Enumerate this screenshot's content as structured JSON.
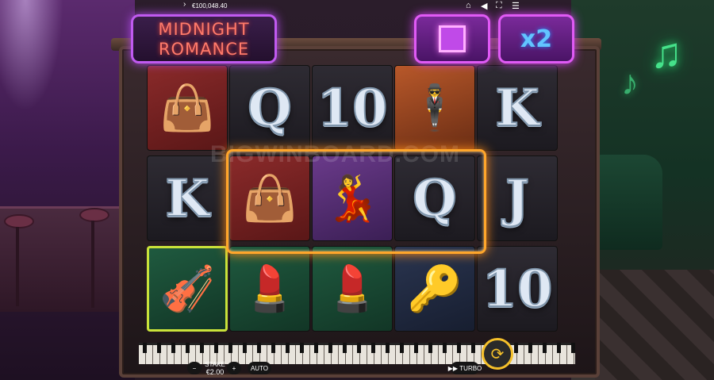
{
  "title": {
    "line1": "MIDNIGHT",
    "line2": "ROMANCE"
  },
  "feature": {
    "multiplier": "x2",
    "cube_icon": "cube-icon"
  },
  "topbar": {
    "balance": "€100,048.40",
    "icons": [
      "home-icon",
      "sound-icon",
      "fullscreen-icon",
      "menu-icon"
    ]
  },
  "watermark": "BIGWINBOARD.COM",
  "bottombar": {
    "stake_label": "STAKE",
    "stake_value": "€2.00",
    "minus": "−",
    "plus": "+",
    "auto": "AUTO",
    "turbo": "TURBO",
    "spin_icon": "spin-icon"
  },
  "grid": [
    [
      "handbag",
      "K",
      "man-bass",
      ""
    ],
    [
      "Q",
      "handbag",
      "compact",
      ""
    ],
    [
      "10",
      "woman",
      "compact",
      ""
    ],
    [
      "man-glasses",
      "Q",
      "keys",
      ""
    ],
    [
      "K",
      "J",
      "10",
      ""
    ]
  ],
  "reels": [
    [
      {
        "sym": "handbag",
        "style": "red",
        "glyph": "👜"
      },
      {
        "sym": "K",
        "style": "plain",
        "glyph": "K"
      },
      {
        "sym": "man-bass",
        "style": "green",
        "glyph": "🎻"
      }
    ],
    [
      {
        "sym": "Q",
        "style": "plain",
        "glyph": "Q"
      },
      {
        "sym": "handbag",
        "style": "red",
        "glyph": "👜"
      },
      {
        "sym": "compact",
        "style": "green",
        "glyph": "💄"
      }
    ],
    [
      {
        "sym": "10",
        "style": "plain",
        "glyph": "10"
      },
      {
        "sym": "woman",
        "style": "purple",
        "glyph": "💃"
      },
      {
        "sym": "compact",
        "style": "green",
        "glyph": "💄"
      }
    ],
    [
      {
        "sym": "man-glasses",
        "style": "orange",
        "glyph": "🕴"
      },
      {
        "sym": "Q",
        "style": "plain",
        "glyph": "Q"
      },
      {
        "sym": "keys",
        "style": "blue",
        "glyph": "🔑"
      }
    ],
    [
      {
        "sym": "K",
        "style": "plain",
        "glyph": "K"
      },
      {
        "sym": "J",
        "style": "plain",
        "glyph": "J"
      },
      {
        "sym": "10",
        "style": "plain",
        "glyph": "10"
      }
    ]
  ],
  "colors": {
    "accent": "#e05af5",
    "win_frame": "#ffa62b",
    "spin": "#f5c02a",
    "neon_notes": "#4dff9c"
  }
}
